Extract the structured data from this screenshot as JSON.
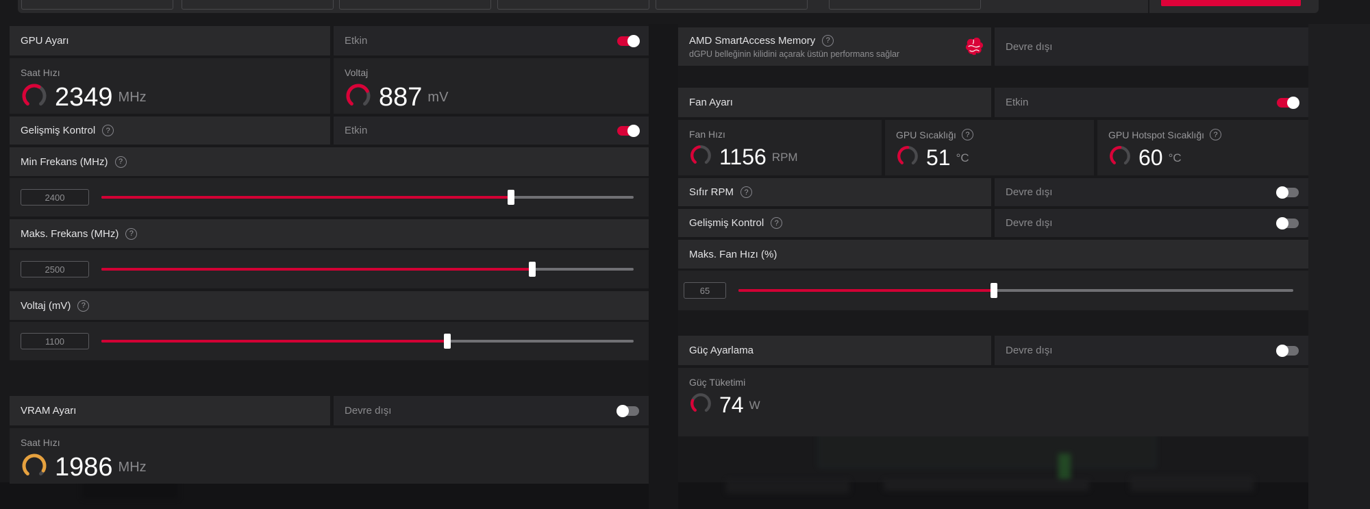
{
  "colors": {
    "accent": "#d90238",
    "vram_gauge": "#e6a13e",
    "gauge_base": "#4a4a4d"
  },
  "top_strip": {
    "accent_button_label": ""
  },
  "gpu_section": {
    "title": "GPU Ayarı",
    "status": "Etkin",
    "enabled": true,
    "clock": {
      "label": "Saat Hızı",
      "value": "2349",
      "unit": "MHz",
      "fraction": 0.6,
      "color": "#d90238"
    },
    "voltage": {
      "label": "Voltaj",
      "value": "887",
      "unit": "mV",
      "fraction": 0.72,
      "color": "#d90238"
    },
    "advanced": {
      "label": "Gelişmiş Kontrol",
      "status": "Etkin",
      "enabled": true
    },
    "sliders": [
      {
        "label": "Min Frekans (MHz)",
        "value": "2400",
        "fill_pct": 77
      },
      {
        "label": "Maks. Frekans (MHz)",
        "value": "2500",
        "fill_pct": 81
      },
      {
        "label": "Voltaj (mV)",
        "value": "1100",
        "fill_pct": 65
      }
    ]
  },
  "vram_section": {
    "title": "VRAM Ayarı",
    "status": "Devre dışı",
    "enabled": false,
    "clock": {
      "label": "Saat Hızı",
      "value": "1986",
      "unit": "MHz",
      "fraction": 0.92,
      "color": "#e6a13e"
    }
  },
  "sam_section": {
    "title": "AMD SmartAccess Memory",
    "subtitle": "dGPU belleğinin kilidini açarak üstün performans sağlar",
    "status": "Devre dışı"
  },
  "fan_section": {
    "title": "Fan Ayarı",
    "status": "Etkin",
    "enabled": true,
    "gauges": [
      {
        "label": "Fan Hızı",
        "value": "1156",
        "unit": "RPM",
        "fraction": 0.46,
        "color": "#d90238"
      },
      {
        "label": "GPU Sıcaklığı",
        "value": "51",
        "unit": "°C",
        "fraction": 0.5,
        "color": "#d90238"
      },
      {
        "label": "GPU Hotspot Sıcaklığı",
        "value": "60",
        "unit": "°C",
        "fraction": 0.5,
        "color": "#d90238"
      }
    ],
    "zero_rpm": {
      "label": "Sıfır RPM",
      "status": "Devre dışı",
      "enabled": false
    },
    "advanced": {
      "label": "Gelişmiş Kontrol",
      "status": "Devre dışı",
      "enabled": false
    },
    "max_fan": {
      "label": "Maks. Fan Hızı (%)",
      "value": "65",
      "fill_pct": 46
    }
  },
  "power_section": {
    "title": "Güç Ayarlama",
    "status": "Devre dışı",
    "enabled": false,
    "consumption": {
      "label": "Güç Tüketimi",
      "value": "74",
      "unit": "W",
      "fraction": 0.25,
      "color": "#d90238"
    }
  }
}
